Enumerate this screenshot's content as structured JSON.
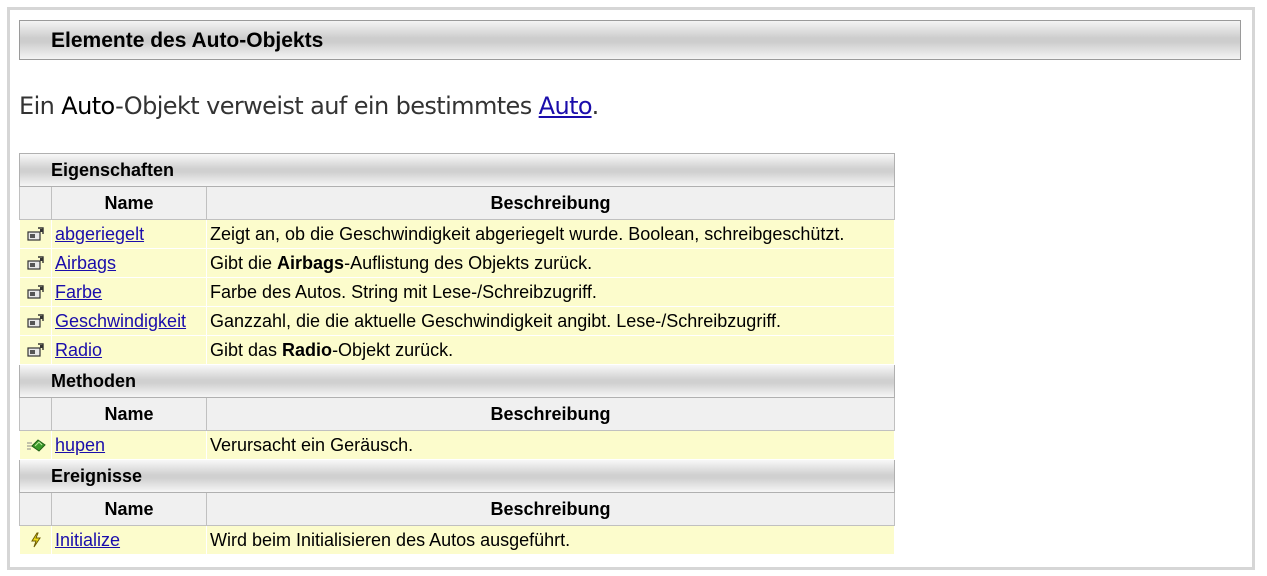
{
  "page": {
    "title": "Elemente des Auto-Objekts",
    "intro": {
      "prefix": "Ein ",
      "object_name": "Auto",
      "middle": "-Objekt verweist auf ein bestimmtes ",
      "link": "Auto",
      "suffix": "."
    }
  },
  "columns": {
    "name": "Name",
    "description": "Beschreibung"
  },
  "sections": {
    "properties": {
      "title": "Eigenschaften",
      "icon": "property-icon",
      "rows": [
        {
          "name": "abgeriegelt",
          "desc": "Zeigt an, ob die Geschwindigkeit abgeriegelt wurde. Boolean, schreibgeschützt."
        },
        {
          "name": "Airbags",
          "desc_pre": "Gibt die ",
          "desc_bold": "Airbags",
          "desc_post": "-Auflistung des Objekts zurück."
        },
        {
          "name": "Farbe",
          "desc": "Farbe des Autos. String mit Lese-/Schreibzugriff."
        },
        {
          "name": "Geschwindigkeit",
          "desc": "Ganzzahl, die die aktuelle Geschwindigkeit angibt. Lese-/Schreibzugriff."
        },
        {
          "name": "Radio",
          "desc_pre": "Gibt das ",
          "desc_bold": "Radio",
          "desc_post": "-Objekt zurück."
        }
      ]
    },
    "methods": {
      "title": "Methoden",
      "icon": "method-icon",
      "rows": [
        {
          "name": "hupen",
          "desc": "Verursacht ein Geräusch."
        }
      ]
    },
    "events": {
      "title": "Ereignisse",
      "icon": "event-icon",
      "rows": [
        {
          "name": "Initialize",
          "desc": "Wird beim Initialisieren des Autos ausgeführt."
        }
      ]
    }
  },
  "colors": {
    "row_background": "#fcfccc",
    "link": "#1a0dab",
    "header_background": "#f0f0f0"
  }
}
